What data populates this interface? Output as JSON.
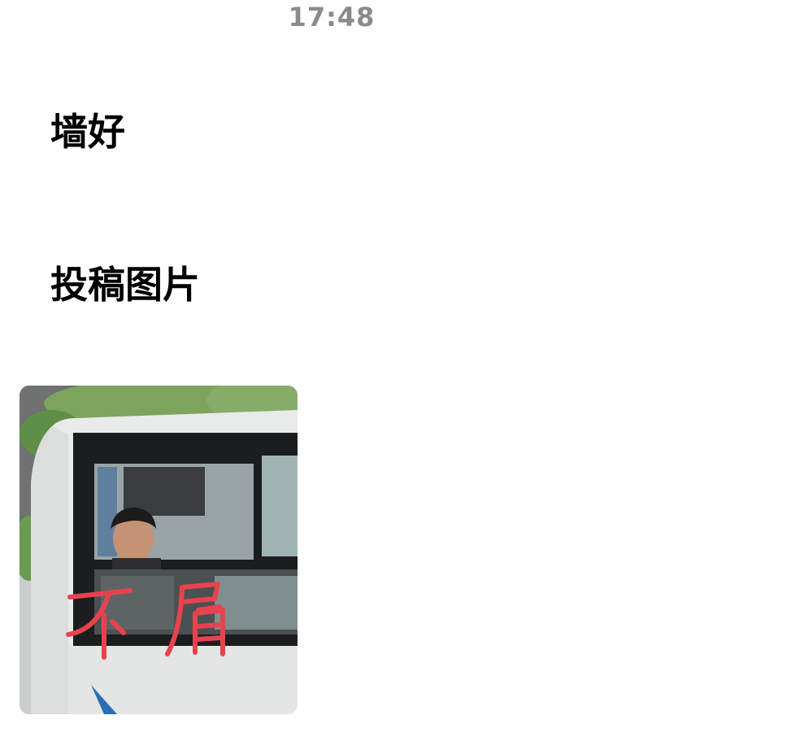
{
  "status_bar": {
    "time": "17:48"
  },
  "greeting": "墙好",
  "section": {
    "title": "投稿图片"
  },
  "submitted_image": {
    "handwritten_overlay_text": "不屑",
    "overlay_color": "#e8424f"
  }
}
